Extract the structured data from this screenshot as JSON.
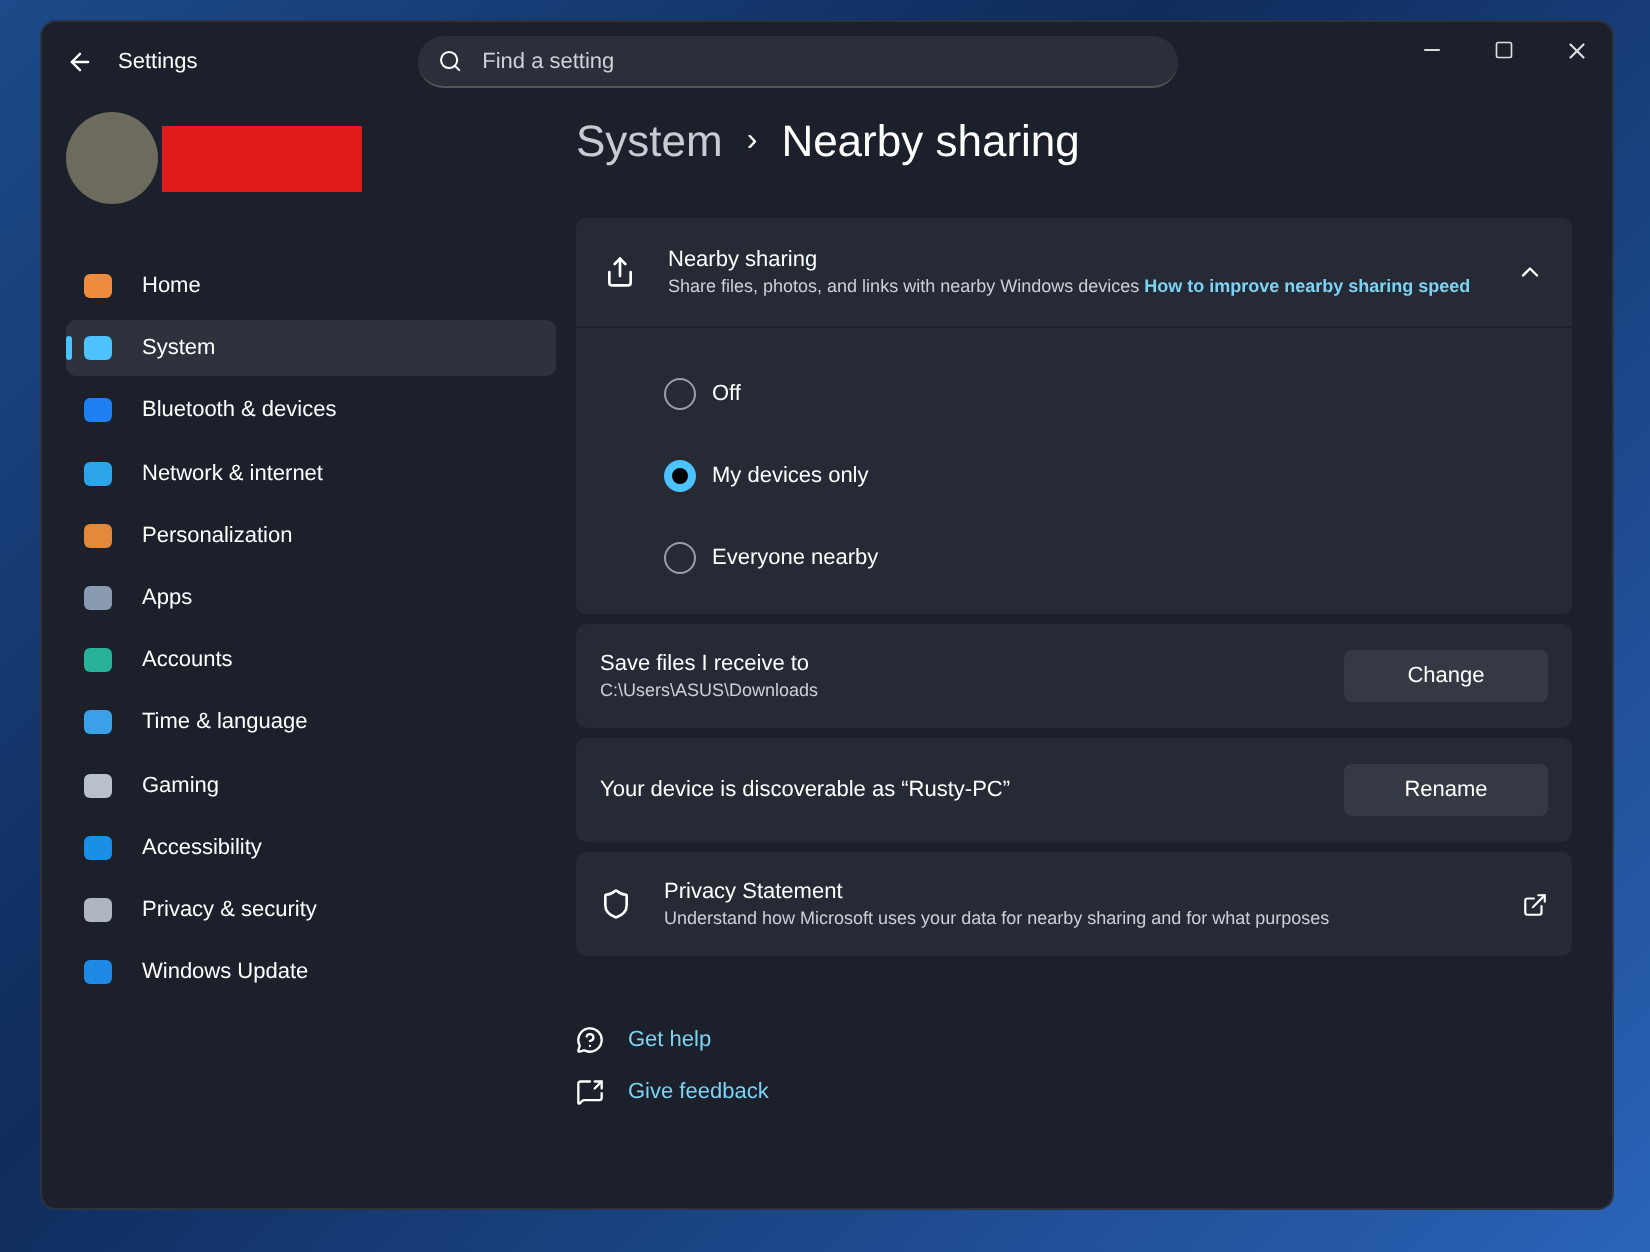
{
  "window": {
    "title": "Settings"
  },
  "search": {
    "placeholder": "Find a setting"
  },
  "sidebar": {
    "items": [
      {
        "label": "Home",
        "selected": false
      },
      {
        "label": "System",
        "selected": true
      },
      {
        "label": "Bluetooth & devices",
        "selected": false
      },
      {
        "label": "Network & internet",
        "selected": false
      },
      {
        "label": "Personalization",
        "selected": false
      },
      {
        "label": "Apps",
        "selected": false
      },
      {
        "label": "Accounts",
        "selected": false
      },
      {
        "label": "Time & language",
        "selected": false
      },
      {
        "label": "Gaming",
        "selected": false
      },
      {
        "label": "Accessibility",
        "selected": false
      },
      {
        "label": "Privacy & security",
        "selected": false
      },
      {
        "label": "Windows Update",
        "selected": false
      }
    ]
  },
  "breadcrumb": {
    "parent": "System",
    "separator": "›",
    "current": "Nearby sharing"
  },
  "nearby_sharing": {
    "title": "Nearby sharing",
    "description": "Share files, photos, and links with nearby Windows devices",
    "link": "How to improve nearby sharing speed",
    "expanded": true,
    "options": [
      {
        "label": "Off",
        "selected": false
      },
      {
        "label": "My devices only",
        "selected": true
      },
      {
        "label": "Everyone nearby",
        "selected": false
      }
    ]
  },
  "save_location": {
    "title": "Save files I receive to",
    "path": "C:\\Users\\ASUS\\Downloads",
    "button": "Change"
  },
  "device_name": {
    "text": "Your device is discoverable as “Rusty-PC”",
    "button": "Rename"
  },
  "privacy": {
    "title": "Privacy Statement",
    "description": "Understand how Microsoft uses your data for nearby sharing and for what purposes"
  },
  "help_links": [
    "Get help",
    "Give feedback"
  ]
}
